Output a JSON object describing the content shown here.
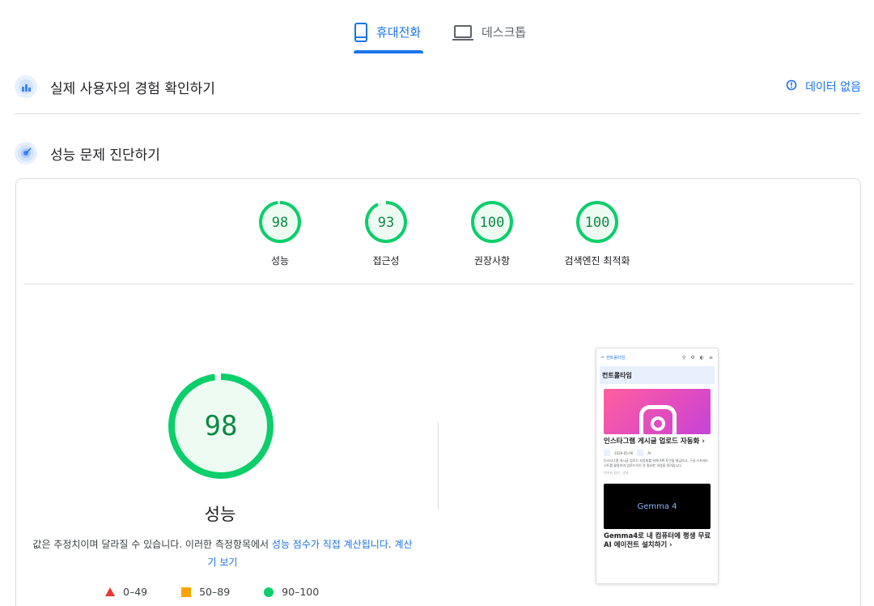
{
  "tabs": {
    "mobile": "휴대전화",
    "desktop": "데스크톱"
  },
  "field_data": {
    "title": "실제 사용자의 경험 확인하기",
    "status": "데이터 없음"
  },
  "diagnose": {
    "title": "성능 문제 진단하기"
  },
  "scores": [
    {
      "value": 98,
      "label": "성능",
      "color": "#0cce6b"
    },
    {
      "value": 93,
      "label": "접근성",
      "color": "#0cce6b"
    },
    {
      "value": 100,
      "label": "권장사항",
      "color": "#0cce6b"
    },
    {
      "value": 100,
      "label": "검색엔진 최적화",
      "color": "#0cce6b"
    }
  ],
  "performance": {
    "score": 98,
    "label": "성능",
    "desc_text": "값은 추정치이며 달라질 수 있습니다. 이러한 측정항목에서 ",
    "desc_link1": "성능 점수가 직접 계산됩니다",
    "desc_link2": "계산기 보기"
  },
  "legend": [
    "0–49",
    "50–89",
    "90–100"
  ],
  "thumbnail": {
    "site_name": "컨트롤타임",
    "header": "컨트롤타임",
    "post1_title": "인스타그램 게시글 업로드 자동화 ›",
    "post1_date": "2026-05-06",
    "post1_tag": "AI",
    "post1_body": "인스타그램 게시글 업로드 자동화를 위해 API 토큰을 발급하고, 구글 스프레드시트를 활용하여 업로드하기 전 필요한 과정을 알려줍니다.",
    "post1_foot": "이어서 읽기 · 공유",
    "post2_image_text": "Gemma 4",
    "post2_title": "Gemma4로 내 컴퓨터에 평생 무료 AI 에이전트 설치하기 ›"
  }
}
